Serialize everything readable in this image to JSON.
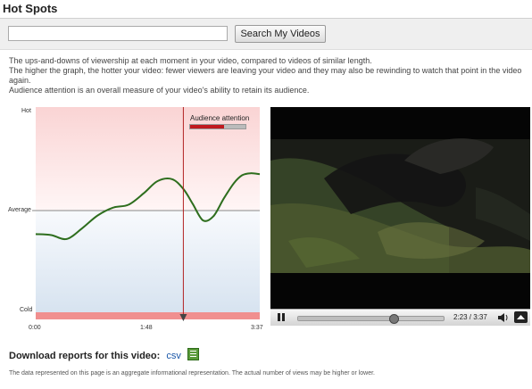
{
  "header": {
    "title": "Hot Spots"
  },
  "search": {
    "value": "",
    "placeholder": "",
    "button_label": "Search My Videos"
  },
  "description": {
    "line1": "The ups-and-downs of viewership at each moment in your video, compared to videos of similar length.",
    "line2": "The higher the graph, the hotter your video: fewer viewers are leaving your video and they may also be rewinding to watch that point in the video again.",
    "line3": "Audience attention is an overall measure of your video's ability to retain its audience."
  },
  "chart_data": {
    "type": "line",
    "title": "",
    "y_tick_labels": [
      "Hot",
      "Average",
      "Cold"
    ],
    "x_tick_labels": [
      "0:00",
      "1:48",
      "3:37"
    ],
    "x_range_seconds": [
      0,
      217
    ],
    "series": [
      {
        "x_seconds": [
          0,
          15,
          30,
          45,
          60,
          75,
          90,
          105,
          118,
          132,
          143,
          152,
          162,
          172,
          182,
          192,
          200,
          208,
          217
        ],
        "attention": [
          -0.24,
          -0.25,
          -0.29,
          -0.18,
          -0.05,
          0.03,
          0.06,
          0.18,
          0.3,
          0.32,
          0.22,
          0.07,
          -0.1,
          -0.06,
          0.12,
          0.28,
          0.36,
          0.38,
          0.37
        ]
      }
    ],
    "current_time_marker": "2:23",
    "legend": {
      "label": "Audience attention",
      "level": 0.62
    },
    "colors": {
      "line": "#2e6e1e",
      "hot": "#fbdcdc",
      "cold": "#dde8f3",
      "marker": "#b22222",
      "average_line": "#888888"
    }
  },
  "player": {
    "time_display": "2:23 / 3:37",
    "progress": 0.659
  },
  "download": {
    "label": "Download reports for this video:",
    "csv_link": "csv"
  },
  "footnote": "The data represented on this page is an aggregate informational representation. The actual number of views may be higher or lower.",
  "icons": {
    "play_pause": "pause-icon",
    "volume": "volume-icon",
    "fullscreen": "fullscreen-icon",
    "csv": "spreadsheet-icon"
  }
}
